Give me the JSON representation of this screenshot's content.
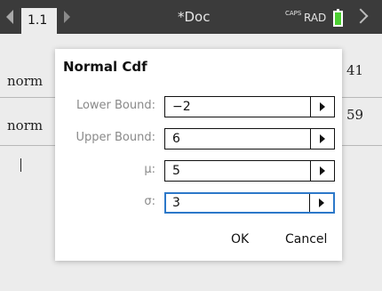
{
  "topbar": {
    "tab_label": "1.1",
    "doc_title": "*Doc",
    "caps_label": "CAPS",
    "angle_mode": "RAD"
  },
  "document": {
    "lines": [
      {
        "text": "norm",
        "result": "41"
      },
      {
        "text": "norm",
        "result": "59"
      }
    ]
  },
  "dialog": {
    "title": "Normal Cdf",
    "fields": [
      {
        "label": "Lower Bound:",
        "value": "−2"
      },
      {
        "label": "Upper Bound:",
        "value": "6"
      },
      {
        "label": "μ:",
        "value": "5"
      },
      {
        "label": "σ:",
        "value": "3"
      }
    ],
    "ok_label": "OK",
    "cancel_label": "Cancel"
  },
  "colors": {
    "topbar": "#3b3b3b",
    "battery": "#4ccf32",
    "focus": "#2c78c9"
  }
}
